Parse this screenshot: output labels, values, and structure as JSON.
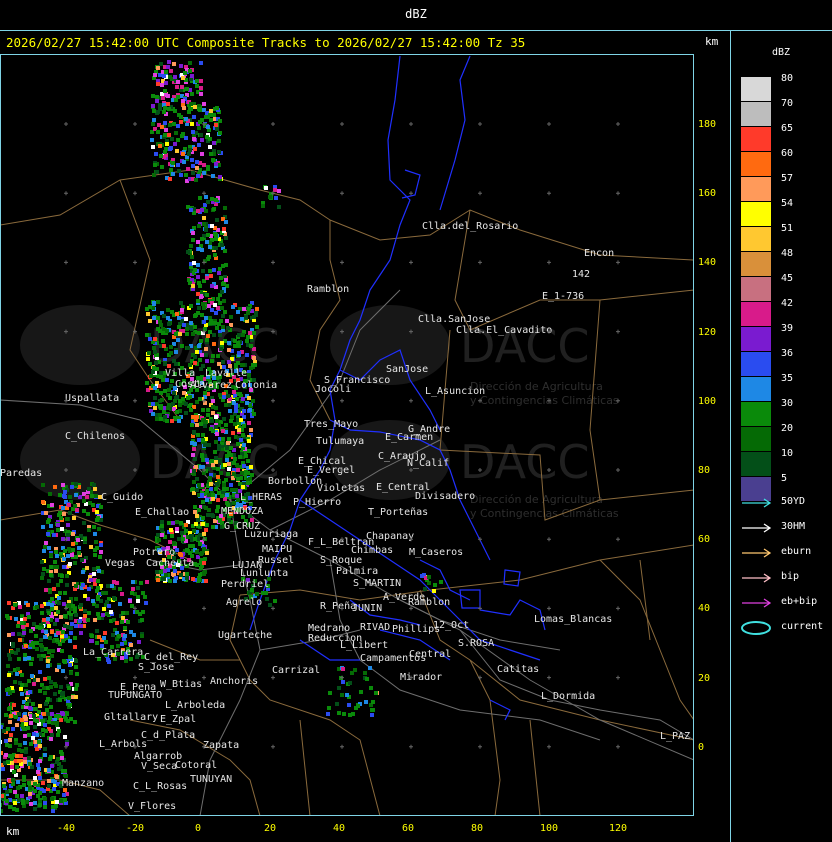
{
  "title": "dBZ",
  "header": "2026/02/27 15:42:00 UTC Composite Tracks to 2026/02/27 15:42:00 Tz 35",
  "km_label": "km",
  "legend": {
    "unit": "dBZ",
    "levels": [
      {
        "value": "80",
        "color": "#d8d8d8"
      },
      {
        "value": "70",
        "color": "#bdbdbd"
      },
      {
        "value": "65",
        "color": "#ff3a2a"
      },
      {
        "value": "60",
        "color": "#ff6a10"
      },
      {
        "value": "57",
        "color": "#ff9a5a"
      },
      {
        "value": "54",
        "color": "#ffff00"
      },
      {
        "value": "51",
        "color": "#ffc830"
      },
      {
        "value": "48",
        "color": "#d9903a"
      },
      {
        "value": "45",
        "color": "#c87080"
      },
      {
        "value": "42",
        "color": "#d81b8a"
      },
      {
        "value": "39",
        "color": "#7a1bd0"
      },
      {
        "value": "36",
        "color": "#2a4cf0"
      },
      {
        "value": "35",
        "color": "#1e88e5"
      },
      {
        "value": "30",
        "color": "#0a8a0a"
      },
      {
        "value": "20",
        "color": "#056a05"
      },
      {
        "value": "10",
        "color": "#034f18"
      },
      {
        "value": "5",
        "color": "#4a3f90"
      }
    ],
    "tracks": [
      {
        "label": "50YD",
        "color": "#40e0e0",
        "shape": "arrow"
      },
      {
        "label": "30HM",
        "color": "#ffffff",
        "shape": "arrow"
      },
      {
        "label": "eburn",
        "color": "#ffc870",
        "shape": "arrow"
      },
      {
        "label": "bip",
        "color": "#ffc0c8",
        "shape": "arrow"
      },
      {
        "label": "eb+bip",
        "color": "#e040e0",
        "shape": "arrow"
      },
      {
        "label": "current",
        "color": "#40e0e0",
        "shape": "ellipse"
      }
    ]
  },
  "axes": {
    "y_ticks": [
      "180",
      "160",
      "140",
      "120",
      "100",
      "80",
      "60",
      "40",
      "20",
      "0"
    ],
    "x_ticks": [
      "-40",
      "-20",
      "0",
      "20",
      "40",
      "60",
      "80",
      "100",
      "120"
    ]
  },
  "watermark": {
    "brand": "DACC",
    "line1": "Dirección de Agricultura",
    "line2": "y Contingencias Climáticas"
  },
  "places": [
    {
      "name": "Clla.del_Rosario",
      "x": 422,
      "y": 229
    },
    {
      "name": "Encon",
      "x": 584,
      "y": 256
    },
    {
      "name": "142",
      "x": 572,
      "y": 277
    },
    {
      "name": "E_1-736",
      "x": 542,
      "y": 299
    },
    {
      "name": "Ramblon",
      "x": 307,
      "y": 292
    },
    {
      "name": "Clla.SanJose",
      "x": 418,
      "y": 322
    },
    {
      "name": "Clla.El_Cavadito",
      "x": 456,
      "y": 333
    },
    {
      "name": "Uspallata",
      "x": 65,
      "y": 401
    },
    {
      "name": "Villa",
      "x": 165,
      "y": 376
    },
    {
      "name": "Lavalle",
      "x": 205,
      "y": 376
    },
    {
      "name": "Jocoli",
      "x": 315,
      "y": 392
    },
    {
      "name": "Costa",
      "x": 175,
      "y": 387
    },
    {
      "name": "Alvarez",
      "x": 190,
      "y": 388
    },
    {
      "name": "Colonia",
      "x": 235,
      "y": 388
    },
    {
      "name": "S_Francisco",
      "x": 324,
      "y": 383
    },
    {
      "name": "SanJose",
      "x": 386,
      "y": 372
    },
    {
      "name": "L_Asuncion",
      "x": 425,
      "y": 394
    },
    {
      "name": "Tres_Mayo",
      "x": 304,
      "y": 427
    },
    {
      "name": "G_Andre",
      "x": 408,
      "y": 432
    },
    {
      "name": "E_Carmen",
      "x": 385,
      "y": 440
    },
    {
      "name": "Tulumaya",
      "x": 316,
      "y": 444
    },
    {
      "name": "C_Chilenos",
      "x": 65,
      "y": 439
    },
    {
      "name": "E_Chical",
      "x": 298,
      "y": 464
    },
    {
      "name": "C_Araujo",
      "x": 378,
      "y": 459
    },
    {
      "name": "N_Calif",
      "x": 407,
      "y": 466
    },
    {
      "name": "E_Vergel",
      "x": 307,
      "y": 473
    },
    {
      "name": "Paredas",
      "x": 0,
      "y": 476
    },
    {
      "name": "Borbollon",
      "x": 268,
      "y": 484
    },
    {
      "name": "Violetas",
      "x": 317,
      "y": 491
    },
    {
      "name": "E_Central",
      "x": 376,
      "y": 490
    },
    {
      "name": "Divisadero",
      "x": 415,
      "y": 499
    },
    {
      "name": "C_Guido",
      "x": 101,
      "y": 500
    },
    {
      "name": "L_HERAS",
      "x": 240,
      "y": 500
    },
    {
      "name": "P_Hierro",
      "x": 293,
      "y": 505
    },
    {
      "name": "T_Porteñas",
      "x": 368,
      "y": 515
    },
    {
      "name": "E_Challao",
      "x": 135,
      "y": 515
    },
    {
      "name": "MENDOZA",
      "x": 221,
      "y": 514
    },
    {
      "name": "G_CRUZ",
      "x": 224,
      "y": 529
    },
    {
      "name": "Luzuriaga",
      "x": 244,
      "y": 537
    },
    {
      "name": "Chapanay",
      "x": 366,
      "y": 539
    },
    {
      "name": "F_L_Beltran",
      "x": 308,
      "y": 545
    },
    {
      "name": "Chimbas",
      "x": 351,
      "y": 553
    },
    {
      "name": "M_Caseros",
      "x": 409,
      "y": 555
    },
    {
      "name": "MAIPU",
      "x": 262,
      "y": 552
    },
    {
      "name": "Russel",
      "x": 258,
      "y": 563
    },
    {
      "name": "S_Roque",
      "x": 320,
      "y": 563
    },
    {
      "name": "Potrero",
      "x": 133,
      "y": 555
    },
    {
      "name": "Vegas",
      "x": 105,
      "y": 566
    },
    {
      "name": "Cacheuta",
      "x": 146,
      "y": 566
    },
    {
      "name": "LUJAN",
      "x": 232,
      "y": 568
    },
    {
      "name": "Lunlunta",
      "x": 240,
      "y": 576
    },
    {
      "name": "Palmira",
      "x": 336,
      "y": 574
    },
    {
      "name": "S_MARTIN",
      "x": 353,
      "y": 586
    },
    {
      "name": "Perdriel",
      "x": 221,
      "y": 587
    },
    {
      "name": "A_Verde",
      "x": 383,
      "y": 600
    },
    {
      "name": "Ramblon",
      "x": 408,
      "y": 605
    },
    {
      "name": "Agrelo",
      "x": 226,
      "y": 605
    },
    {
      "name": "R_Peña",
      "x": 320,
      "y": 609
    },
    {
      "name": "JUNIN",
      "x": 352,
      "y": 611
    },
    {
      "name": "Lomas_Blancas",
      "x": 534,
      "y": 622
    },
    {
      "name": "12_Oct",
      "x": 433,
      "y": 628
    },
    {
      "name": "Medrano",
      "x": 308,
      "y": 631
    },
    {
      "name": "RIVAD",
      "x": 360,
      "y": 630
    },
    {
      "name": "Phillips",
      "x": 392,
      "y": 632
    },
    {
      "name": "Ugarteche",
      "x": 218,
      "y": 638
    },
    {
      "name": "Reduccion",
      "x": 308,
      "y": 641
    },
    {
      "name": "S.ROSA",
      "x": 458,
      "y": 646
    },
    {
      "name": "La_Carrera",
      "x": 83,
      "y": 655
    },
    {
      "name": "C_del_Rey",
      "x": 144,
      "y": 660
    },
    {
      "name": "L_Libert",
      "x": 340,
      "y": 648
    },
    {
      "name": "Central",
      "x": 409,
      "y": 657
    },
    {
      "name": "Campamentos",
      "x": 360,
      "y": 661
    },
    {
      "name": "S_Jose",
      "x": 138,
      "y": 670
    },
    {
      "name": "Carrizal",
      "x": 272,
      "y": 673
    },
    {
      "name": "Catitas",
      "x": 497,
      "y": 672
    },
    {
      "name": "Anchoris",
      "x": 210,
      "y": 684
    },
    {
      "name": "Mirador",
      "x": 400,
      "y": 680
    },
    {
      "name": "W_Btias",
      "x": 160,
      "y": 687
    },
    {
      "name": "E_Pena",
      "x": 120,
      "y": 690
    },
    {
      "name": "TUPUNGATO",
      "x": 108,
      "y": 698
    },
    {
      "name": "L_Dormida",
      "x": 541,
      "y": 699
    },
    {
      "name": "L_Arboleda",
      "x": 165,
      "y": 708
    },
    {
      "name": "Gltallary",
      "x": 104,
      "y": 720
    },
    {
      "name": "E_Zpal",
      "x": 160,
      "y": 722
    },
    {
      "name": "C_d_Plata",
      "x": 141,
      "y": 738
    },
    {
      "name": "L_PAZ",
      "x": 660,
      "y": 739
    },
    {
      "name": "L_Arbols",
      "x": 99,
      "y": 747
    },
    {
      "name": "Zapata",
      "x": 203,
      "y": 748
    },
    {
      "name": "Algarrob",
      "x": 134,
      "y": 759
    },
    {
      "name": "V_Seca",
      "x": 141,
      "y": 769
    },
    {
      "name": "Cotoral",
      "x": 175,
      "y": 768
    },
    {
      "name": "TUNUYAN",
      "x": 190,
      "y": 782
    },
    {
      "name": "Manzano",
      "x": 62,
      "y": 786
    },
    {
      "name": "C_L_Rosas",
      "x": 133,
      "y": 789
    },
    {
      "name": "V_Flores",
      "x": 128,
      "y": 809
    }
  ]
}
